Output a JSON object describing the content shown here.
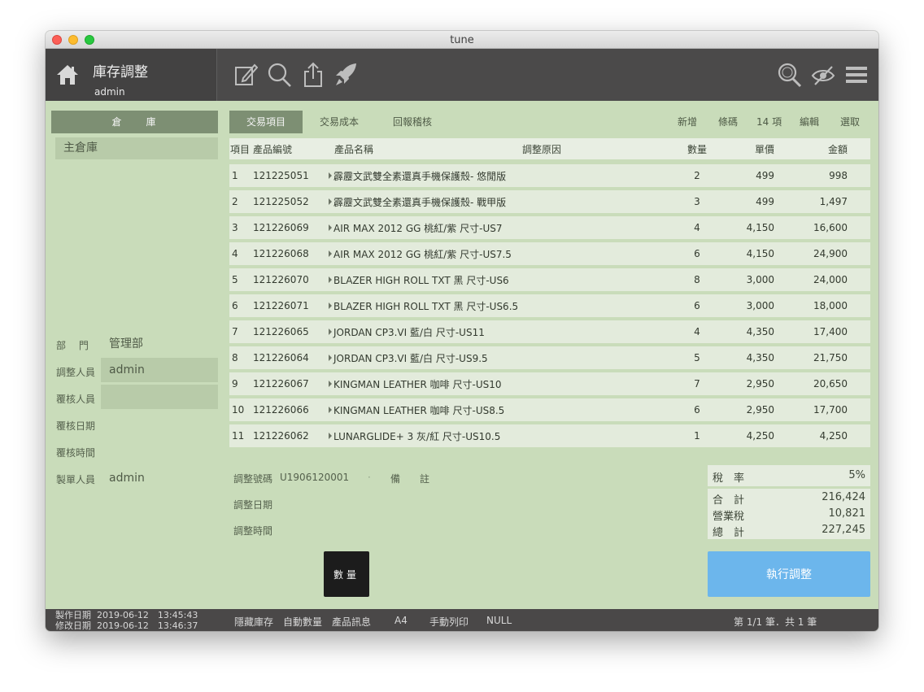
{
  "window": {
    "title": "tune"
  },
  "header": {
    "title": "庫存調整",
    "user": "admin",
    "tools": [
      "edit-icon",
      "search-icon",
      "share-icon",
      "rocket-icon"
    ],
    "right_tools": [
      "search-icon",
      "eye-slash-icon",
      "menu-icon"
    ]
  },
  "sidebar": {
    "heading": "倉　　庫",
    "warehouses": [
      "主倉庫"
    ],
    "fields": [
      {
        "label": "部　 門",
        "value": "管理部",
        "boxed": false
      },
      {
        "label": "調整人員",
        "value": "admin",
        "boxed": true
      },
      {
        "label": "覆核人員",
        "value": "",
        "boxed": true
      },
      {
        "label": "覆核日期",
        "value": "",
        "boxed": false
      },
      {
        "label": "覆核時間",
        "value": "",
        "boxed": false
      },
      {
        "label": "製單人員",
        "value": "admin",
        "boxed": false
      }
    ]
  },
  "tabs": [
    {
      "label": "交易項目",
      "active": true
    },
    {
      "label": "交易成本",
      "active": false
    },
    {
      "label": "回報稽核",
      "active": false
    }
  ],
  "actions": {
    "add": "新增",
    "barcode": "條碼",
    "count": "14 項",
    "edit": "編輯",
    "select": "選取"
  },
  "table": {
    "columns": [
      "項目",
      "產品編號",
      "產品名稱",
      "調整原因",
      "數量",
      "單價",
      "金額"
    ],
    "rows": [
      {
        "no": "1",
        "code": "121225051",
        "name": "霹靂文武雙全素還真手機保護殼- 悠閒版",
        "reason": "",
        "qty": "2",
        "price": "499",
        "amount": "998"
      },
      {
        "no": "2",
        "code": "121225052",
        "name": "霹靂文武雙全素還真手機保護殼- 戰甲版",
        "reason": "",
        "qty": "3",
        "price": "499",
        "amount": "1,497"
      },
      {
        "no": "3",
        "code": "121226069",
        "name": "AIR MAX 2012 GG 桃紅/紫 尺寸-US7",
        "reason": "",
        "qty": "4",
        "price": "4,150",
        "amount": "16,600"
      },
      {
        "no": "4",
        "code": "121226068",
        "name": "AIR MAX 2012 GG 桃紅/紫 尺寸-US7.5",
        "reason": "",
        "qty": "6",
        "price": "4,150",
        "amount": "24,900"
      },
      {
        "no": "5",
        "code": "121226070",
        "name": "BLAZER HIGH ROLL TXT 黑 尺寸-US6",
        "reason": "",
        "qty": "8",
        "price": "3,000",
        "amount": "24,000"
      },
      {
        "no": "6",
        "code": "121226071",
        "name": "BLAZER HIGH ROLL TXT 黑 尺寸-US6.5",
        "reason": "",
        "qty": "6",
        "price": "3,000",
        "amount": "18,000"
      },
      {
        "no": "7",
        "code": "121226065",
        "name": "JORDAN CP3.VI 藍/白 尺寸-US11",
        "reason": "",
        "qty": "4",
        "price": "4,350",
        "amount": "17,400"
      },
      {
        "no": "8",
        "code": "121226064",
        "name": "JORDAN CP3.VI 藍/白 尺寸-US9.5",
        "reason": "",
        "qty": "5",
        "price": "4,350",
        "amount": "21,750"
      },
      {
        "no": "9",
        "code": "121226067",
        "name": "KINGMAN LEATHER 咖啡 尺寸-US10",
        "reason": "",
        "qty": "7",
        "price": "2,950",
        "amount": "20,650"
      },
      {
        "no": "10",
        "code": "121226066",
        "name": "KINGMAN LEATHER 咖啡 尺寸-US8.5",
        "reason": "",
        "qty": "6",
        "price": "2,950",
        "amount": "17,700"
      },
      {
        "no": "11",
        "code": "121226062",
        "name": "LUNARGLIDE+ 3 灰/紅 尺寸-US10.5",
        "reason": "",
        "qty": "1",
        "price": "4,250",
        "amount": "4,250"
      }
    ]
  },
  "info": {
    "adj_no_label": "調整號碼",
    "adj_no": "U1906120001",
    "note_label": "備　　註",
    "adj_date_label": "調整日期",
    "adj_time_label": "調整時間"
  },
  "totals": {
    "tax_rate_label": "稅　率",
    "tax_rate": "5%",
    "subtotal_label": "合　計",
    "subtotal": "216,424",
    "tax_label": "營業稅",
    "tax": "10,821",
    "total_label": "總　計",
    "total": "227,245"
  },
  "buttons": {
    "qty": "數量",
    "execute": "執行調整"
  },
  "footer": {
    "created_label": "製作日期",
    "created": "2019-06-12　13:45:43",
    "modified_label": "修改日期",
    "modified": "2019-06-12　13:46:37",
    "items": [
      "隱藏庫存",
      "自動數量",
      "產品訊息",
      "A4",
      "手動列印",
      "NULL"
    ],
    "pager": "第 1/1 筆．共 1 筆"
  },
  "colors": {
    "background": "#c9dcba",
    "header": "#4b4a4a",
    "accent": "#7d8f73",
    "execute": "#6cb6ec"
  }
}
